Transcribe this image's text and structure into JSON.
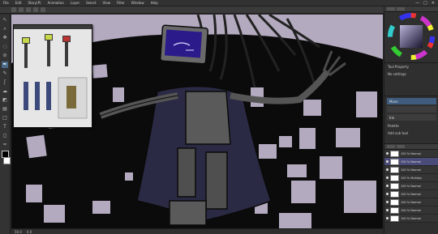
{
  "menu": {
    "items": [
      "File",
      "Edit",
      "Story(P)",
      "Animation",
      "Layer",
      "Select",
      "View",
      "Filter",
      "Window",
      "Help"
    ]
  },
  "window_controls": [
    "—",
    "□",
    "✕"
  ],
  "tools": [
    "pointer-icon",
    "magnifier-icon",
    "move-icon",
    "lasso-icon",
    "eyedropper-icon",
    "pen-icon",
    "pencil-icon",
    "brush-icon",
    "airbrush-icon",
    "fill-icon",
    "gradient-icon",
    "figure-icon",
    "text-icon",
    "eraser-icon",
    "blend-icon"
  ],
  "tool_glyphs": [
    "↖",
    "⌕",
    "✥",
    "◌",
    "⊘",
    "✒",
    "✎",
    "ʃ",
    "☁",
    "◩",
    "▤",
    "□",
    "T",
    "◻",
    "≈"
  ],
  "status": {
    "zoom": "50.0",
    "angle": "0.0"
  },
  "panels": {
    "tool_property": "Tool Property",
    "no_settings": "No settings",
    "mid_rows": [
      "Move",
      "",
      "Ink"
    ],
    "mid_footer": "Palette",
    "mid_sub": "Add sub tool"
  },
  "layers": [
    {
      "name": "100 %  Normal",
      "selected": false
    },
    {
      "name": "100 %  Normal",
      "selected": true
    },
    {
      "name": "100 %  Normal",
      "selected": false
    },
    {
      "name": "100 %  Multiply",
      "selected": false
    },
    {
      "name": "100 %  Normal",
      "selected": false
    },
    {
      "name": "100 %  Normal",
      "selected": false
    },
    {
      "name": "100 %  Normal",
      "selected": false
    },
    {
      "name": "100 %  Normal",
      "selected": false
    },
    {
      "name": "100 %  Normal",
      "selected": false
    }
  ],
  "colors": {
    "canvas_bg": "#b3aabf",
    "ink": "#0a0a0a",
    "screen": "#2a1a8a",
    "cape": "#2b2a45",
    "ui_dark": "#2f2f2f",
    "accent": "#3f5c7f"
  }
}
